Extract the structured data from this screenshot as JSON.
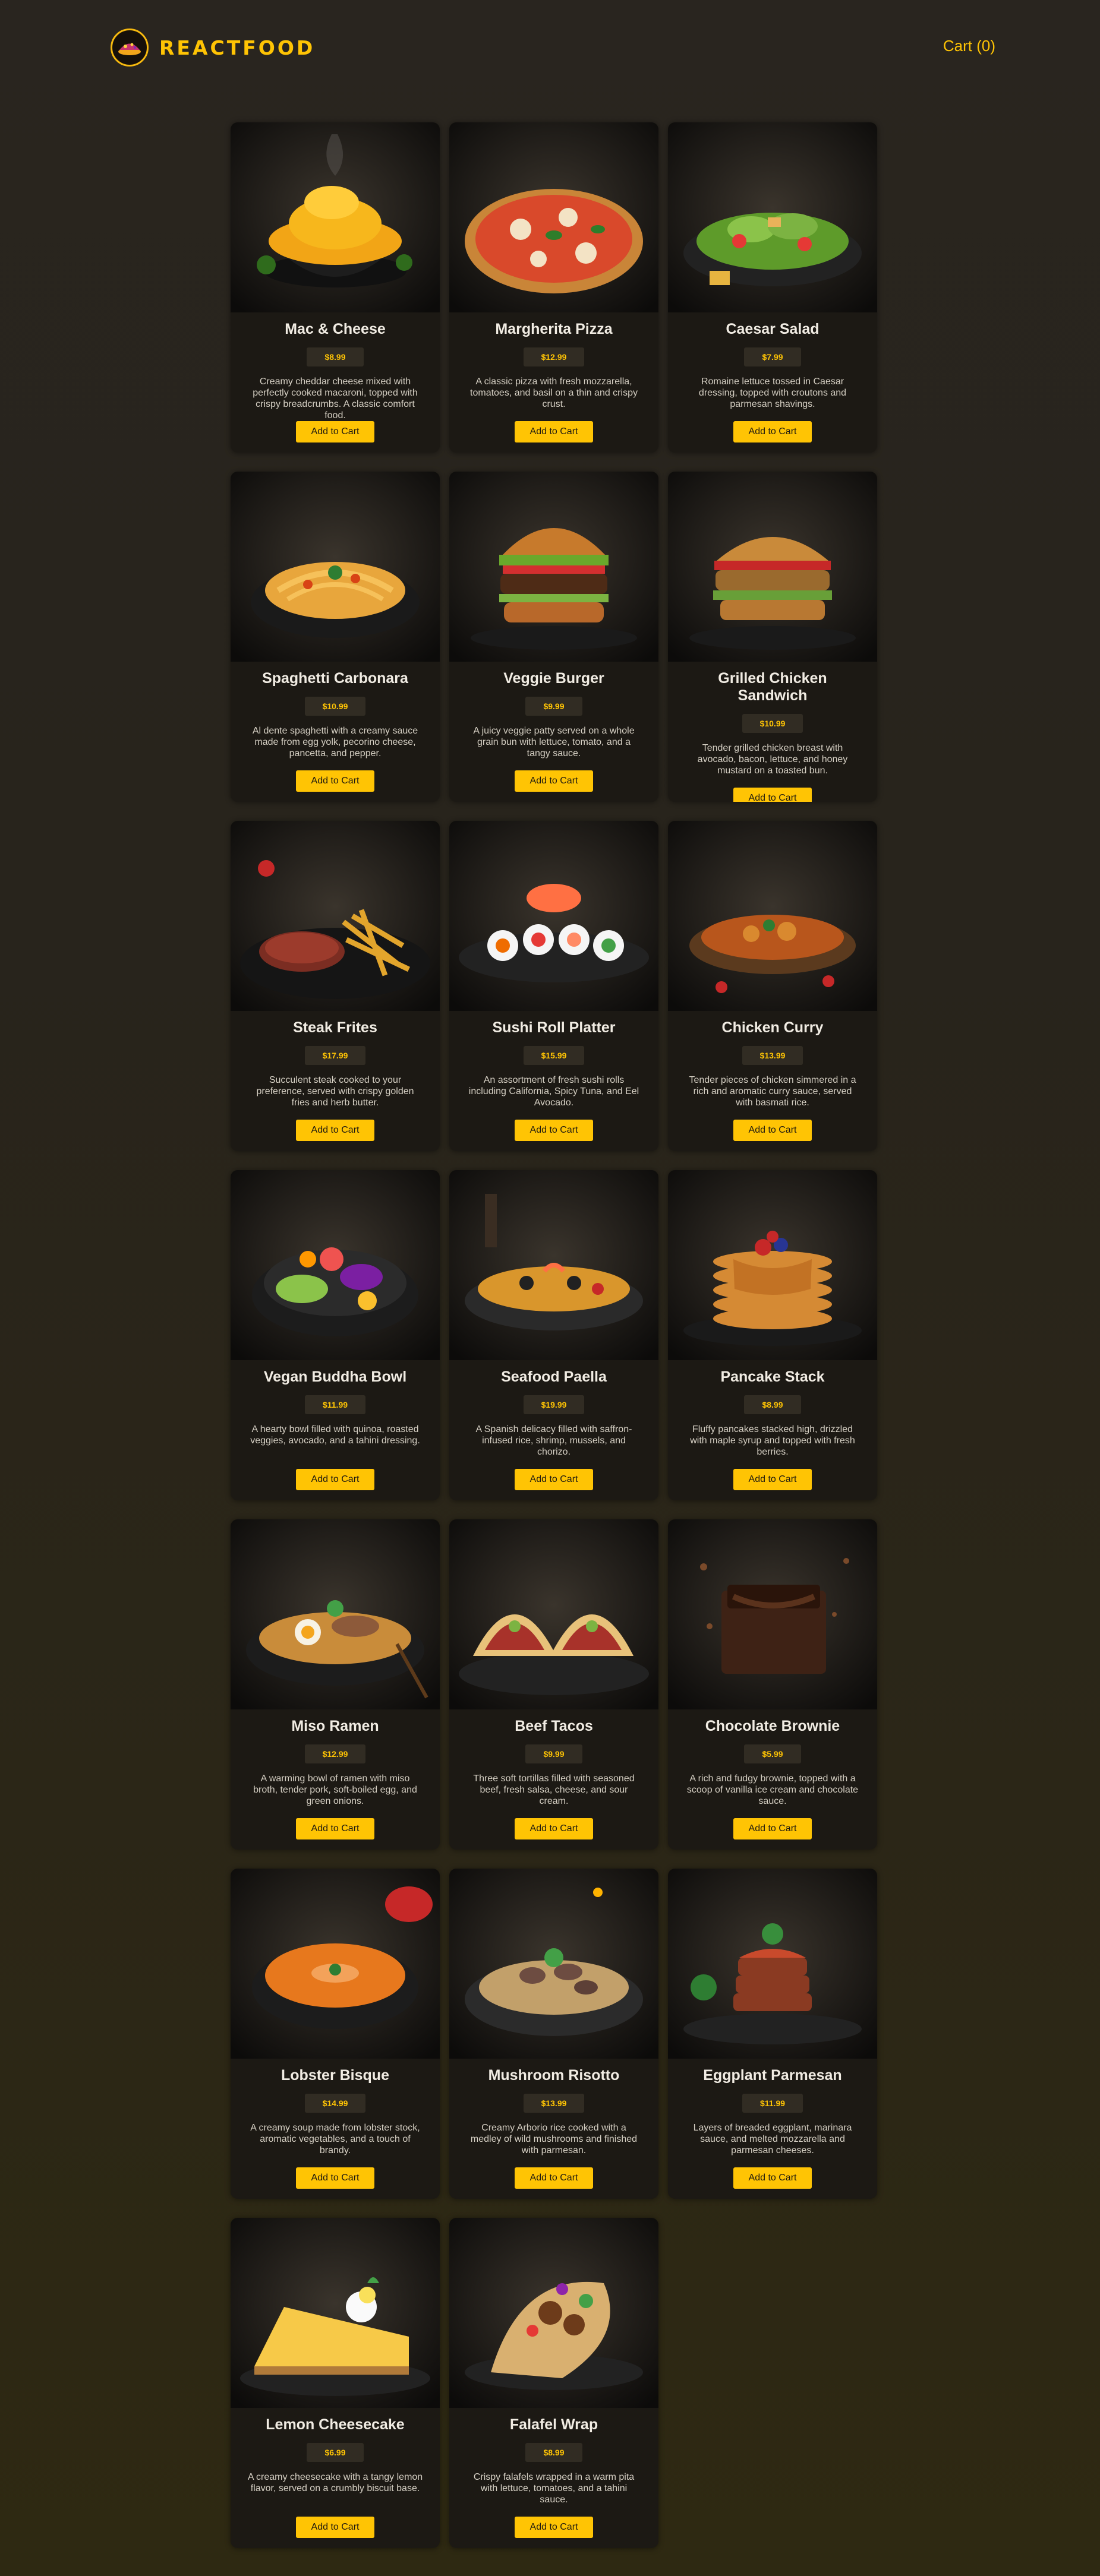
{
  "brand": {
    "title": "REACTFOOD"
  },
  "cart": {
    "label": "Cart (0)"
  },
  "accent": "#ffc404",
  "meals": [
    {
      "name": "Mac & Cheese",
      "price": "$8.99",
      "description": "Creamy cheddar cheese mixed with perfectly cooked macaroni, topped with crispy breadcrumbs. A classic comfort food.",
      "button": "Add to Cart",
      "food": "bowl-cheese-pasta"
    },
    {
      "name": "Margherita Pizza",
      "price": "$12.99",
      "description": "A classic pizza with fresh mozzarella, tomatoes, and basil on a thin and crispy crust.",
      "button": "Add to Cart",
      "food": "pizza"
    },
    {
      "name": "Caesar Salad",
      "price": "$7.99",
      "description": "Romaine lettuce tossed in Caesar dressing, topped with croutons and parmesan shavings.",
      "button": "Add to Cart",
      "food": "salad"
    },
    {
      "name": "Spaghetti Carbonara",
      "price": "$10.99",
      "description": "Al dente spaghetti with a creamy sauce made from egg yolk, pecorino cheese, pancetta, and pepper.",
      "button": "Add to Cart",
      "food": "pasta"
    },
    {
      "name": "Veggie Burger",
      "price": "$9.99",
      "description": "A juicy veggie patty served on a whole grain bun with lettuce, tomato, and a tangy sauce.",
      "button": "Add to Cart",
      "food": "burger"
    },
    {
      "name": "Grilled Chicken Sandwich",
      "price": "$10.99",
      "description": "Tender grilled chicken breast with avocado, bacon, lettuce, and honey mustard on a toasted bun.",
      "button": "Add to Cart",
      "food": "sandwich"
    },
    {
      "name": "Steak Frites",
      "price": "$17.99",
      "description": "Succulent steak cooked to your preference, served with crispy golden fries and herb butter.",
      "button": "Add to Cart",
      "food": "steak"
    },
    {
      "name": "Sushi Roll Platter",
      "price": "$15.99",
      "description": "An assortment of fresh sushi rolls including California, Spicy Tuna, and Eel Avocado.",
      "button": "Add to Cart",
      "food": "sushi"
    },
    {
      "name": "Chicken Curry",
      "price": "$13.99",
      "description": "Tender pieces of chicken simmered in a rich and aromatic curry sauce, served with basmati rice.",
      "button": "Add to Cart",
      "food": "curry"
    },
    {
      "name": "Vegan Buddha Bowl",
      "price": "$11.99",
      "description": "A hearty bowl filled with quinoa, roasted veggies, avocado, and a tahini dressing.",
      "button": "Add to Cart",
      "food": "buddha-bowl"
    },
    {
      "name": "Seafood Paella",
      "price": "$19.99",
      "description": "A Spanish delicacy filled with saffron-infused rice, shrimp, mussels, and chorizo.",
      "button": "Add to Cart",
      "food": "paella"
    },
    {
      "name": "Pancake Stack",
      "price": "$8.99",
      "description": "Fluffy pancakes stacked high, drizzled with maple syrup and topped with fresh berries.",
      "button": "Add to Cart",
      "food": "pancakes"
    },
    {
      "name": "Miso Ramen",
      "price": "$12.99",
      "description": "A warming bowl of ramen with miso broth, tender pork, soft-boiled egg, and green onions.",
      "button": "Add to Cart",
      "food": "ramen"
    },
    {
      "name": "Beef Tacos",
      "price": "$9.99",
      "description": "Three soft tortillas filled with seasoned beef, fresh salsa, cheese, and sour cream.",
      "button": "Add to Cart",
      "food": "tacos"
    },
    {
      "name": "Chocolate Brownie",
      "price": "$5.99",
      "description": "A rich and fudgy brownie, topped with a scoop of vanilla ice cream and chocolate sauce.",
      "button": "Add to Cart",
      "food": "brownie"
    },
    {
      "name": "Lobster Bisque",
      "price": "$14.99",
      "description": "A creamy soup made from lobster stock, aromatic vegetables, and a touch of brandy.",
      "button": "Add to Cart",
      "food": "soup"
    },
    {
      "name": "Mushroom Risotto",
      "price": "$13.99",
      "description": "Creamy Arborio rice cooked with a medley of wild mushrooms and finished with parmesan.",
      "button": "Add to Cart",
      "food": "risotto"
    },
    {
      "name": "Eggplant Parmesan",
      "price": "$11.99",
      "description": "Layers of breaded eggplant, marinara sauce, and melted mozzarella and parmesan cheeses.",
      "button": "Add to Cart",
      "food": "eggplant"
    },
    {
      "name": "Lemon Cheesecake",
      "price": "$6.99",
      "description": "A creamy cheesecake with a tangy lemon flavor, served on a crumbly biscuit base.",
      "button": "Add to Cart",
      "food": "cheesecake"
    },
    {
      "name": "Falafel Wrap",
      "price": "$8.99",
      "description": "Crispy falafels wrapped in a warm pita with lettuce, tomatoes, and a tahini sauce.",
      "button": "Add to Cart",
      "food": "wrap"
    }
  ]
}
